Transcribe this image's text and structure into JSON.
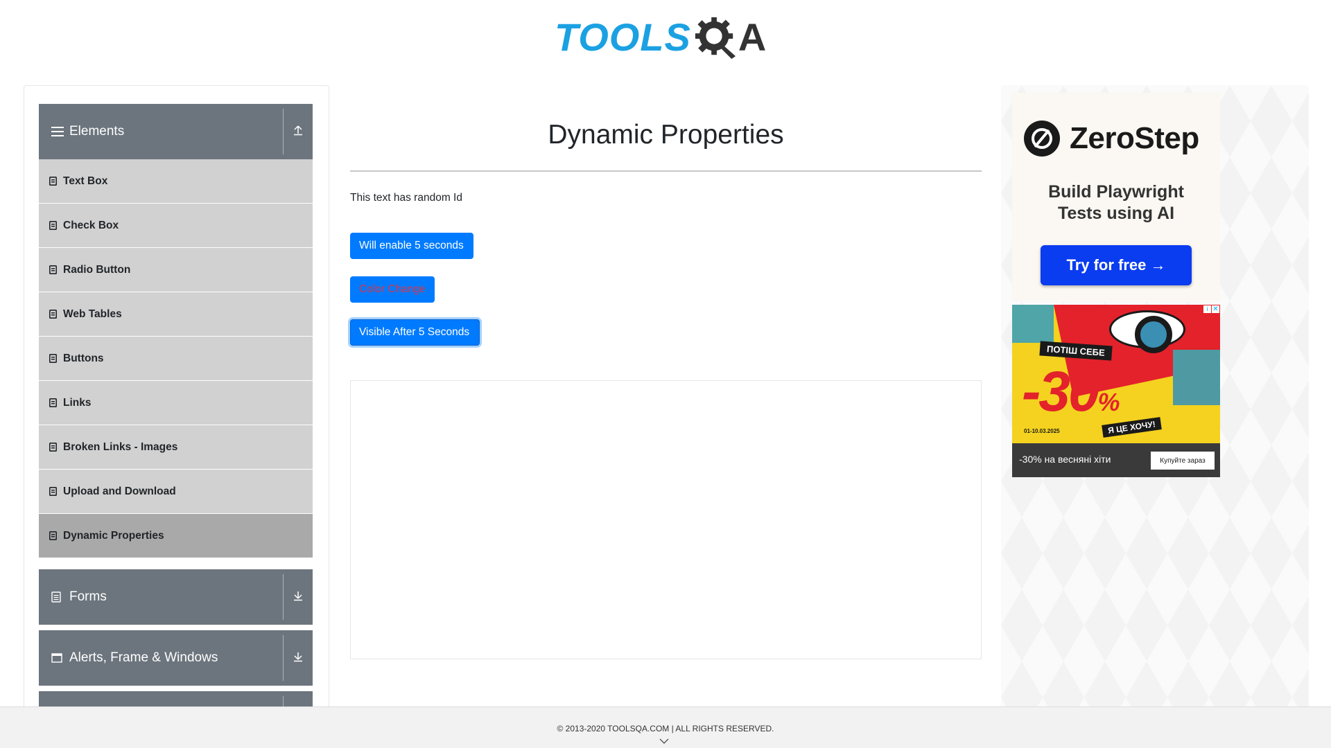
{
  "header": {
    "logo_tools": "TOOLS",
    "logo_qa": "A"
  },
  "sidebar": {
    "groups": [
      {
        "label": "Elements",
        "icon": "hamburger-icon",
        "toggle_icon": "collapse-up-icon",
        "expanded": true
      },
      {
        "label": "Forms",
        "icon": "document-icon",
        "toggle_icon": "expand-down-icon",
        "expanded": false
      },
      {
        "label": "Alerts, Frame & Windows",
        "icon": "window-icon",
        "toggle_icon": "expand-down-icon",
        "expanded": false
      }
    ],
    "items": [
      {
        "label": "Text Box"
      },
      {
        "label": "Check Box"
      },
      {
        "label": "Radio Button"
      },
      {
        "label": "Web Tables"
      },
      {
        "label": "Buttons"
      },
      {
        "label": "Links"
      },
      {
        "label": "Broken Links - Images"
      },
      {
        "label": "Upload and Download"
      },
      {
        "label": "Dynamic Properties",
        "active": true
      }
    ]
  },
  "main": {
    "title": "Dynamic Properties",
    "random_text": "This text has random Id",
    "btn_enable": "Will enable 5 seconds",
    "btn_color": "Color Change",
    "btn_visible": "Visible After 5 Seconds"
  },
  "ads": {
    "zerostep": {
      "name": "ZeroStep",
      "tagline_line1": "Build Playwright",
      "tagline_line2": "Tests using AI",
      "cta": "Try for free →"
    },
    "sale": {
      "band_top": "ПОТІШ СЕБЕ",
      "percent": "-30",
      "percent_sign": "%",
      "date": "01-10.03.2025",
      "band_bottom": "Я ЦЕ ХОЧУ!",
      "bottom_text": "-30% на весняні хіти",
      "bottom_btn": "Купуйте зараз"
    }
  },
  "footer": {
    "text": "© 2013-2020 TOOLSQA.COM | ALL RIGHTS RESERVED."
  },
  "colors": {
    "primary": "#007bff",
    "sidebar_header": "#6c757d",
    "menu_item": "#d1d1d1",
    "menu_active": "#a9a9a9",
    "logo_blue": "#1ba1e2",
    "danger": "#dc3545"
  }
}
